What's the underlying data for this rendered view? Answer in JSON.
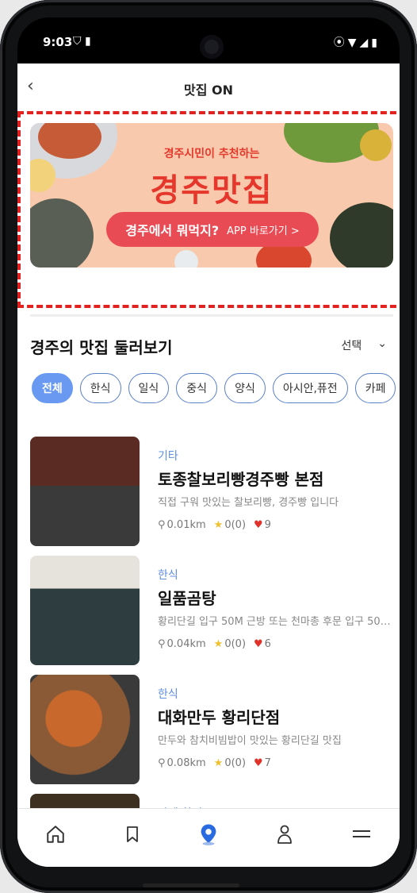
{
  "status": {
    "time": "9:03"
  },
  "header": {
    "title": "맛집 ON"
  },
  "banner": {
    "small": "경주시민이 추천하는",
    "big": "경주맛집",
    "cta_main": "경주에서 뭐먹지?",
    "cta_sub": "APP 바로가기 >"
  },
  "section": {
    "title": "경주의 맛집 둘러보기",
    "sort_label": "선택"
  },
  "chips": [
    "전체",
    "한식",
    "일식",
    "중식",
    "양식",
    "아시안,퓨전",
    "카페"
  ],
  "items": [
    {
      "category": "기타",
      "name": "토종찰보리빵경주빵 본점",
      "desc": "직접 구워 맛있는 찰보리빵, 경주빵 입니다",
      "distance": "0.01km",
      "rating": "0(0)",
      "likes": "9"
    },
    {
      "category": "한식",
      "name": "일품곰탕",
      "desc": "황리단길 입구 50M 근방 또는 천마총 후문 입구 50M…",
      "distance": "0.04km",
      "rating": "0(0)",
      "likes": "6"
    },
    {
      "category": "한식",
      "name": "대화만두 황리단점",
      "desc": "만두와 참치비빔밥이 맛있는 황리단길 맛집",
      "distance": "0.08km",
      "rating": "0(0)",
      "likes": "7"
    },
    {
      "category": "카페,찻집"
    }
  ],
  "colors": {
    "accent": "#6a99f2",
    "category": "#5f8fe0",
    "heart": "#e0312a",
    "banner_bg": "#f9c9ad",
    "highlight_border": "#e22121"
  }
}
